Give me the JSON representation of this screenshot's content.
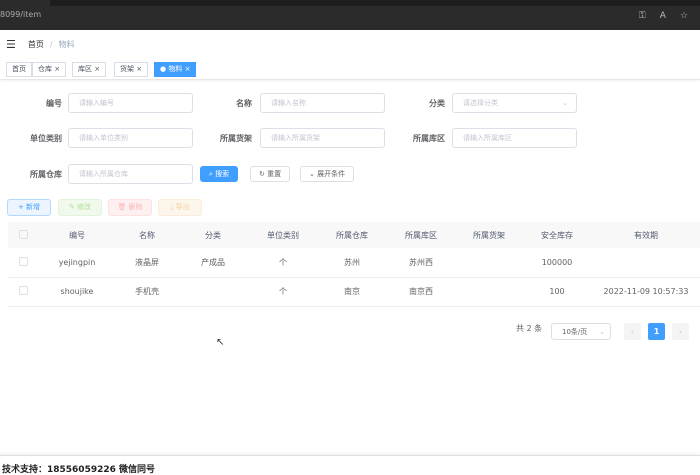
{
  "browser": {
    "address": "8099/item"
  },
  "breadcrumb": {
    "home": "首页",
    "separator": "/",
    "current": "物料"
  },
  "tags": [
    {
      "label": "首页"
    },
    {
      "label": "仓库"
    },
    {
      "label": "库区"
    },
    {
      "label": "货架"
    },
    {
      "label": "物料"
    }
  ],
  "form": {
    "code": {
      "label": "编号",
      "placeholder": "请输入编号"
    },
    "name": {
      "label": "名称",
      "placeholder": "请输入名称"
    },
    "category": {
      "label": "分类",
      "placeholder": "请选择分类"
    },
    "unit": {
      "label": "单位类别",
      "placeholder": "请输入单位类别"
    },
    "rack": {
      "label": "所属货架",
      "placeholder": "请输入所属货架"
    },
    "area": {
      "label": "所属库区",
      "placeholder": "请输入所属库区"
    },
    "warehouse": {
      "label": "所属仓库",
      "placeholder": "请输入所属仓库"
    },
    "search": "搜索",
    "reset": "重置",
    "expand": "展开条件"
  },
  "actions": {
    "add": "+ 新增",
    "edit": "✎ 修改",
    "delete": "🗑 删除",
    "export": "⤓ 导出"
  },
  "table": {
    "headers": [
      "编号",
      "名称",
      "分类",
      "单位类别",
      "所属仓库",
      "所属库区",
      "所属货架",
      "安全库存",
      "有效期"
    ],
    "rows": [
      [
        "yejingpin",
        "液晶屏",
        "产成品",
        "个",
        "苏州",
        "苏州西",
        "",
        "100000",
        ""
      ],
      [
        "shoujike",
        "手机壳",
        "",
        "个",
        "南京",
        "南京西",
        "",
        "100",
        "2022-11-09 10:57:33"
      ]
    ]
  },
  "pagination": {
    "total": "共 2 条",
    "page_size": "10条/页",
    "current": "1"
  },
  "footer": "技术支持：18556059226 微信同号"
}
